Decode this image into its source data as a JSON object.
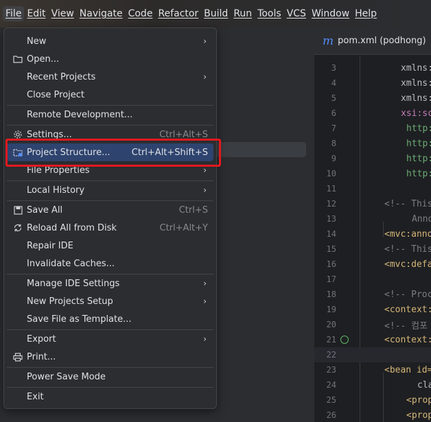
{
  "menubar": {
    "items": [
      "File",
      "Edit",
      "View",
      "Navigate",
      "Code",
      "Refactor",
      "Build",
      "Run",
      "Tools",
      "VCS",
      "Window",
      "Help"
    ]
  },
  "editor_tab": {
    "icon": "m",
    "label": "pom.xml (podhong)"
  },
  "editor_lines": [
    {
      "num": "3",
      "code": "xmlns:"
    },
    {
      "num": "4",
      "code": "xmlns:"
    },
    {
      "num": "5",
      "code": "xmlns:"
    },
    {
      "num": "6",
      "code": "xsi:sc"
    },
    {
      "num": "7",
      "code": "http:"
    },
    {
      "num": "8",
      "code": "http:"
    },
    {
      "num": "9",
      "code": "http:"
    },
    {
      "num": "10",
      "code": "http:"
    },
    {
      "num": "11",
      "code": ""
    },
    {
      "num": "12",
      "code": "<!-- This"
    },
    {
      "num": "13",
      "code": "Anno"
    },
    {
      "num": "14",
      "code": "<mvc:anno"
    },
    {
      "num": "15",
      "code": "<!-- This"
    },
    {
      "num": "16",
      "code": "<mvc:defa"
    },
    {
      "num": "17",
      "code": ""
    },
    {
      "num": "18",
      "code": "<!-- Proc"
    },
    {
      "num": "19",
      "code": "<context:"
    },
    {
      "num": "20",
      "code": "<!-- 컴포"
    },
    {
      "num": "21",
      "code": "<context:"
    },
    {
      "num": "22",
      "code": ""
    },
    {
      "num": "23",
      "code": "<bean id="
    },
    {
      "num": "24",
      "code": "cla"
    },
    {
      "num": "25",
      "code": "<prop"
    },
    {
      "num": "26",
      "code": "<prop"
    }
  ],
  "file_menu": {
    "new": "New",
    "open": "Open...",
    "recent_projects": "Recent Projects",
    "close_project": "Close Project",
    "remote_development": "Remote Development...",
    "settings": "Settings...",
    "settings_shortcut": "Ctrl+Alt+S",
    "project_structure": "Project Structure...",
    "project_structure_shortcut": "Ctrl+Alt+Shift+S",
    "file_properties": "File Properties",
    "local_history": "Local History",
    "save_all": "Save All",
    "save_all_shortcut": "Ctrl+S",
    "reload_all": "Reload All from Disk",
    "reload_all_shortcut": "Ctrl+Alt+Y",
    "repair_ide": "Repair IDE",
    "invalidate_caches": "Invalidate Caches...",
    "manage_ide_settings": "Manage IDE Settings",
    "new_projects_setup": "New Projects Setup",
    "save_file_as_template": "Save File as Template...",
    "export": "Export",
    "print": "Print...",
    "power_save_mode": "Power Save Mode",
    "exit": "Exit"
  },
  "colors": {
    "highlight_box": "#e5191f",
    "selected_item": "#2e436e"
  }
}
